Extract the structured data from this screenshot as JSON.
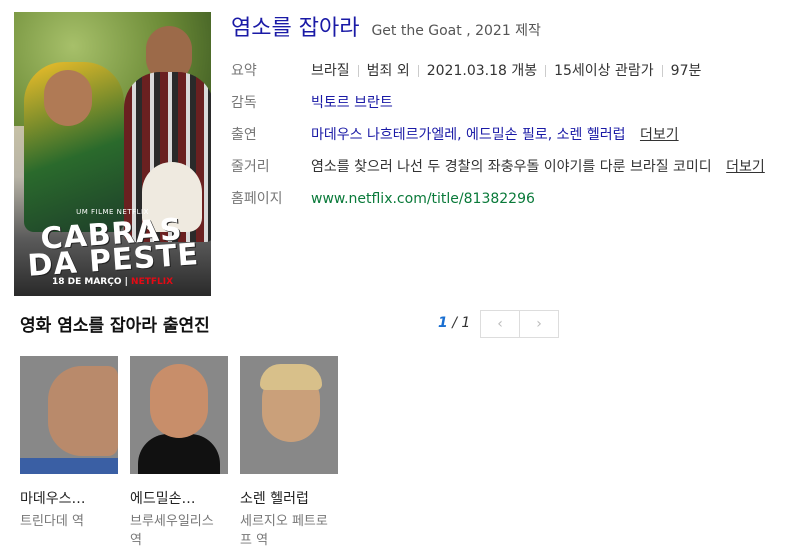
{
  "movie": {
    "title": "염소를 잡아라",
    "original_title": "Get the Goat , 2021 제작"
  },
  "poster": {
    "small_text": "UM FILME NETFLIX",
    "title_text": "CABRAS DA PESTE",
    "date_text": "18 DE MARÇO",
    "brand_text": "NETFLIX"
  },
  "info": {
    "summary_label": "요약",
    "summary": [
      "브라질",
      "범죄 외",
      "2021.03.18 개봉",
      "15세이상 관람가",
      "97분"
    ],
    "director_label": "감독",
    "director": "빅토르 브란트",
    "cast_label": "출연",
    "cast": "마데우스 나흐테르가엘레, 에드밀손 필로, 소렌 헬러럽",
    "cast_more": "더보기",
    "plot_label": "줄거리",
    "plot": "염소를 찾으러 나선 두 경찰의 좌충우돌 이야기를 다룬 브라질 코미디",
    "plot_more": "더보기",
    "homepage_label": "홈페이지",
    "homepage": "www.netflix.com/title/81382296"
  },
  "cast_section": {
    "heading": "영화 염소를 잡아라 출연진",
    "page_current": "1",
    "page_separator": "/",
    "page_total": "1",
    "prev_label": "‹",
    "next_label": "›",
    "members": [
      {
        "name": "마데우스…",
        "role": "트린다데 역"
      },
      {
        "name": "에드밀손…",
        "role": "브루세우일리스 역"
      },
      {
        "name": "소렌 헬러럽",
        "role": "세르지오 페트로프 역"
      }
    ]
  }
}
